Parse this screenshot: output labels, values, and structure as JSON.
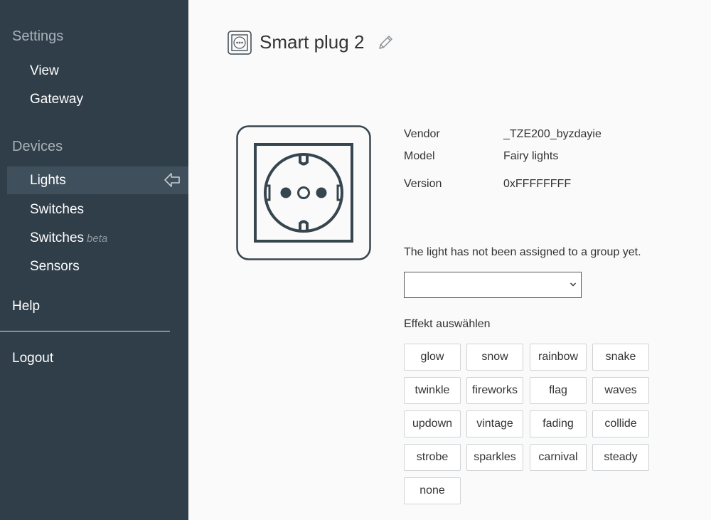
{
  "sidebar": {
    "settings_heading": "Settings",
    "view": "View",
    "gateway": "Gateway",
    "devices_heading": "Devices",
    "lights": "Lights",
    "switches": "Switches",
    "switches_beta": "Switches",
    "beta_tag": "beta",
    "sensors": "Sensors",
    "help": "Help",
    "logout": "Logout"
  },
  "device": {
    "title": "Smart plug 2",
    "vendor_label": "Vendor",
    "vendor_value": "_TZE200_byzdayie",
    "model_label": "Model",
    "model_value": "Fairy lights",
    "version_label": "Version",
    "version_value": "0xFFFFFFFF"
  },
  "group": {
    "message": "The light has not been assigned to a group yet.",
    "selected": ""
  },
  "effects": {
    "heading": "Effekt auswählen",
    "items": [
      "glow",
      "snow",
      "rainbow",
      "snake",
      "twinkle",
      "fireworks",
      "flag",
      "waves",
      "updown",
      "vintage",
      "fading",
      "collide",
      "strobe",
      "sparkles",
      "carnival",
      "steady",
      "none"
    ]
  },
  "colors": {
    "sidebar_bg": "#2f3e49",
    "sidebar_active": "#3f4f5b",
    "icon_stroke": "#37454f"
  }
}
